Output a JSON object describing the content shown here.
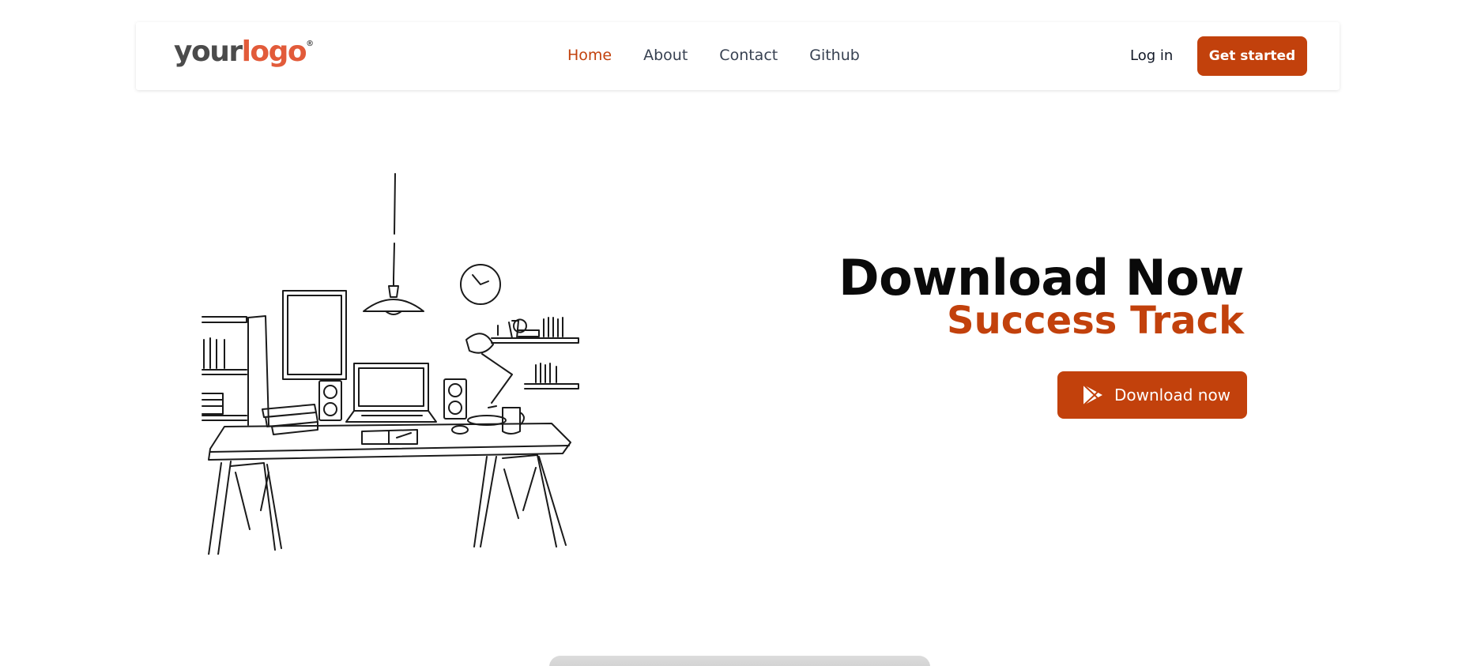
{
  "header": {
    "logo": {
      "word1": "your",
      "word2": "logo",
      "mark": "®"
    },
    "nav": [
      {
        "label": "Home",
        "active": true
      },
      {
        "label": "About",
        "active": false
      },
      {
        "label": "Contact",
        "active": false
      },
      {
        "label": "Github",
        "active": false
      }
    ],
    "login_label": "Log in",
    "cta_label": "Get started"
  },
  "hero": {
    "title": "Download Now",
    "subtitle": "Success Track",
    "download_label": "Download now",
    "download_icon": "play-store-icon",
    "illustration": "desk-workspace-sketch"
  },
  "colors": {
    "accent": "#c2410c",
    "logo_accent": "#e25b3a",
    "text_dark": "#0a0a0a",
    "nav_text": "#374151"
  }
}
